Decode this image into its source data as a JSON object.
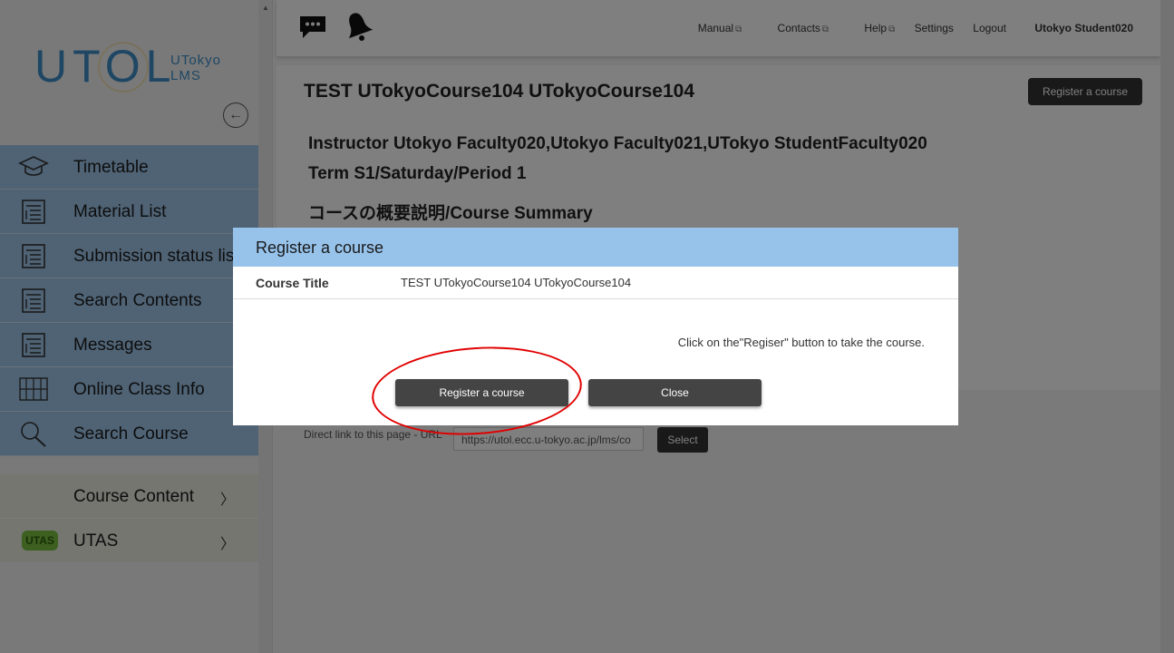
{
  "logo": {
    "main": "UTOL",
    "sub_line1": "UTokyo",
    "sub_line2": "LMS"
  },
  "sidebar": {
    "items": [
      {
        "label": "Timetable",
        "icon": "graduation-cap-icon"
      },
      {
        "label": "Material List",
        "icon": "clipboard-list-icon"
      },
      {
        "label": "Submission status list",
        "icon": "clipboard-list-icon"
      },
      {
        "label": "Search Contents",
        "icon": "clipboard-list-icon"
      },
      {
        "label": "Messages",
        "icon": "clipboard-list-icon"
      },
      {
        "label": "Online Class Info",
        "icon": "grid-icon"
      },
      {
        "label": "Search Course",
        "icon": "magnifier-icon"
      }
    ],
    "sections": [
      {
        "label": "Course Content",
        "chevron": "〉"
      },
      {
        "label": "UTAS",
        "badge": "UTAS",
        "chevron": "〉"
      }
    ]
  },
  "header": {
    "nav": {
      "manual": "Manual",
      "contacts": "Contacts",
      "help": "Help",
      "settings": "Settings",
      "logout": "Logout"
    },
    "user": "Utokyo Student020"
  },
  "course": {
    "title": "TEST UTokyoCourse104 UTokyoCourse104",
    "register_button": "Register a course",
    "instructor": "Instructor Utokyo Faculty020,Utokyo Faculty021,UTokyo StudentFaculty020",
    "term": "Term S1/Saturday/Period 1",
    "summary_heading": "コースの概要説明/Course Summary",
    "direct_link_label": "Direct link to this page - URL",
    "direct_link_value": "https://utol.ecc.u-tokyo.ac.jp/lms/co",
    "select_button": "Select"
  },
  "modal": {
    "title": "Register a course",
    "field_label": "Course Title",
    "field_value": "TEST UTokyoCourse104 UTokyoCourse104",
    "message": "Click on the\"Regiser\" button to take the course.",
    "register_button": "Register a course",
    "close_button": "Close"
  },
  "colors": {
    "sidebar_item": "#9ec6ea",
    "modal_header": "#97c3eb",
    "button": "#444444",
    "annotation": "#e10000"
  }
}
